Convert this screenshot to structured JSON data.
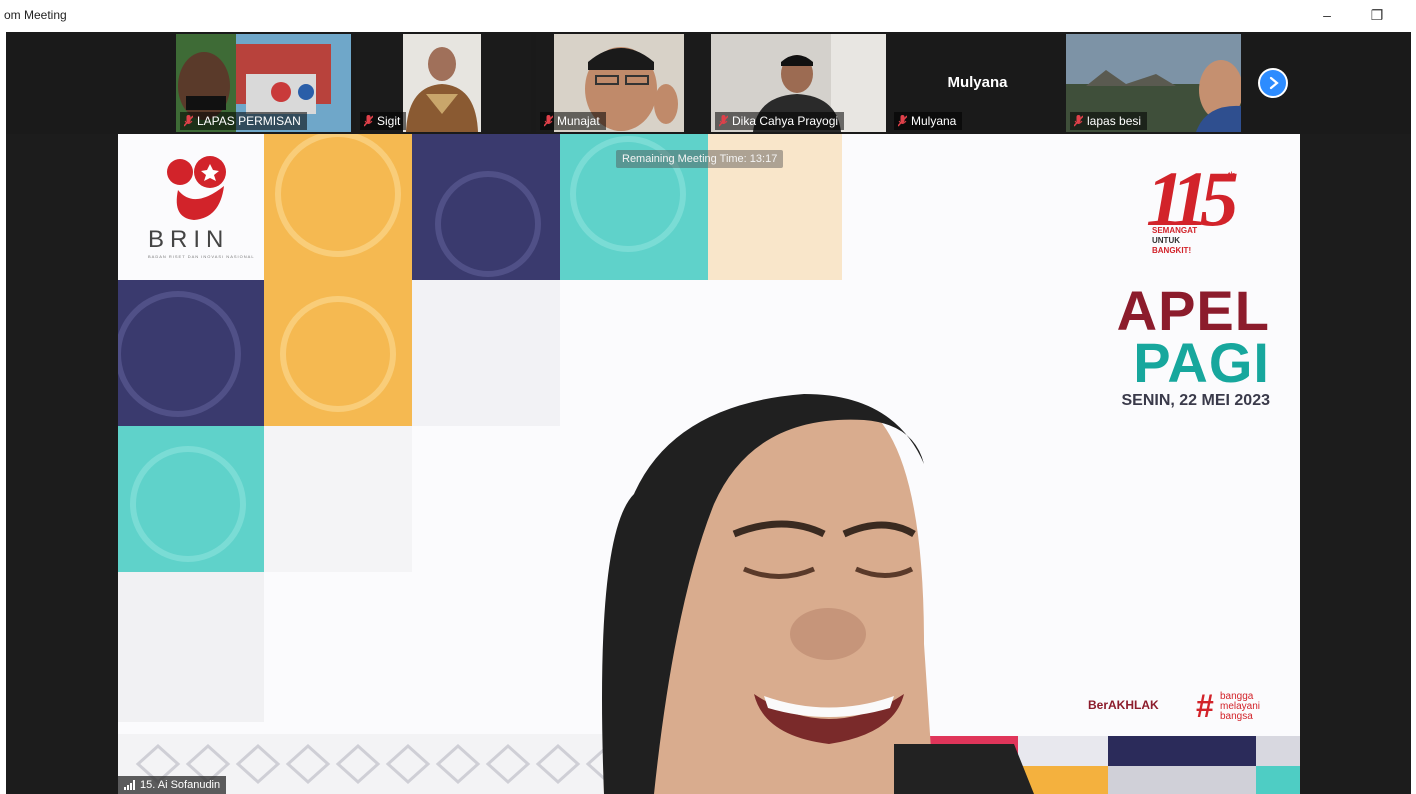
{
  "window": {
    "title": "om Meeting",
    "minimize_glyph": "–",
    "restore_glyph": "❐"
  },
  "meeting": {
    "remaining_time": "Remaining Meeting Time: 13:17",
    "next_page_icon": "chevron-right-icon",
    "participants": [
      {
        "name": "LAPAS PERMISAN",
        "muted": true
      },
      {
        "name": "Sigit",
        "muted": true
      },
      {
        "name": "Munajat",
        "muted": true
      },
      {
        "name": "Dika Cahya Prayogi",
        "muted": true
      },
      {
        "name": "Mulyana",
        "muted": true,
        "video_off": true,
        "display_name": "Mulyana"
      },
      {
        "name": "lapas besi",
        "muted": true
      }
    ],
    "active_speaker": {
      "name": "15. Ai Sofanudin",
      "signal_icon": "signal-bars-icon"
    }
  },
  "slide": {
    "logo_text": "BRIN",
    "logo_subtitle": "BADAN RISET DAN INOVASI NASIONAL",
    "anniversary_number": "115",
    "anniversary_suffix": "th",
    "tagline": [
      "SEMANGAT",
      "UNTUK",
      "BANGKIT!"
    ],
    "heading_1": "APEL",
    "heading_2": "PAGI",
    "date": "SENIN, 22 MEI 2023",
    "footer_logo_1": "BerAKHLAK",
    "footer_logo_2": [
      "bangga",
      "melayani",
      "bangsa"
    ],
    "colors": {
      "brin_red": "#d2232a",
      "apel": "#8c1c2c",
      "pagi": "#17a79d",
      "navy": "#3a3a6e",
      "orange": "#f4b13e",
      "teal": "#4ecdc4",
      "accent_blue": "#2d8cff"
    }
  }
}
